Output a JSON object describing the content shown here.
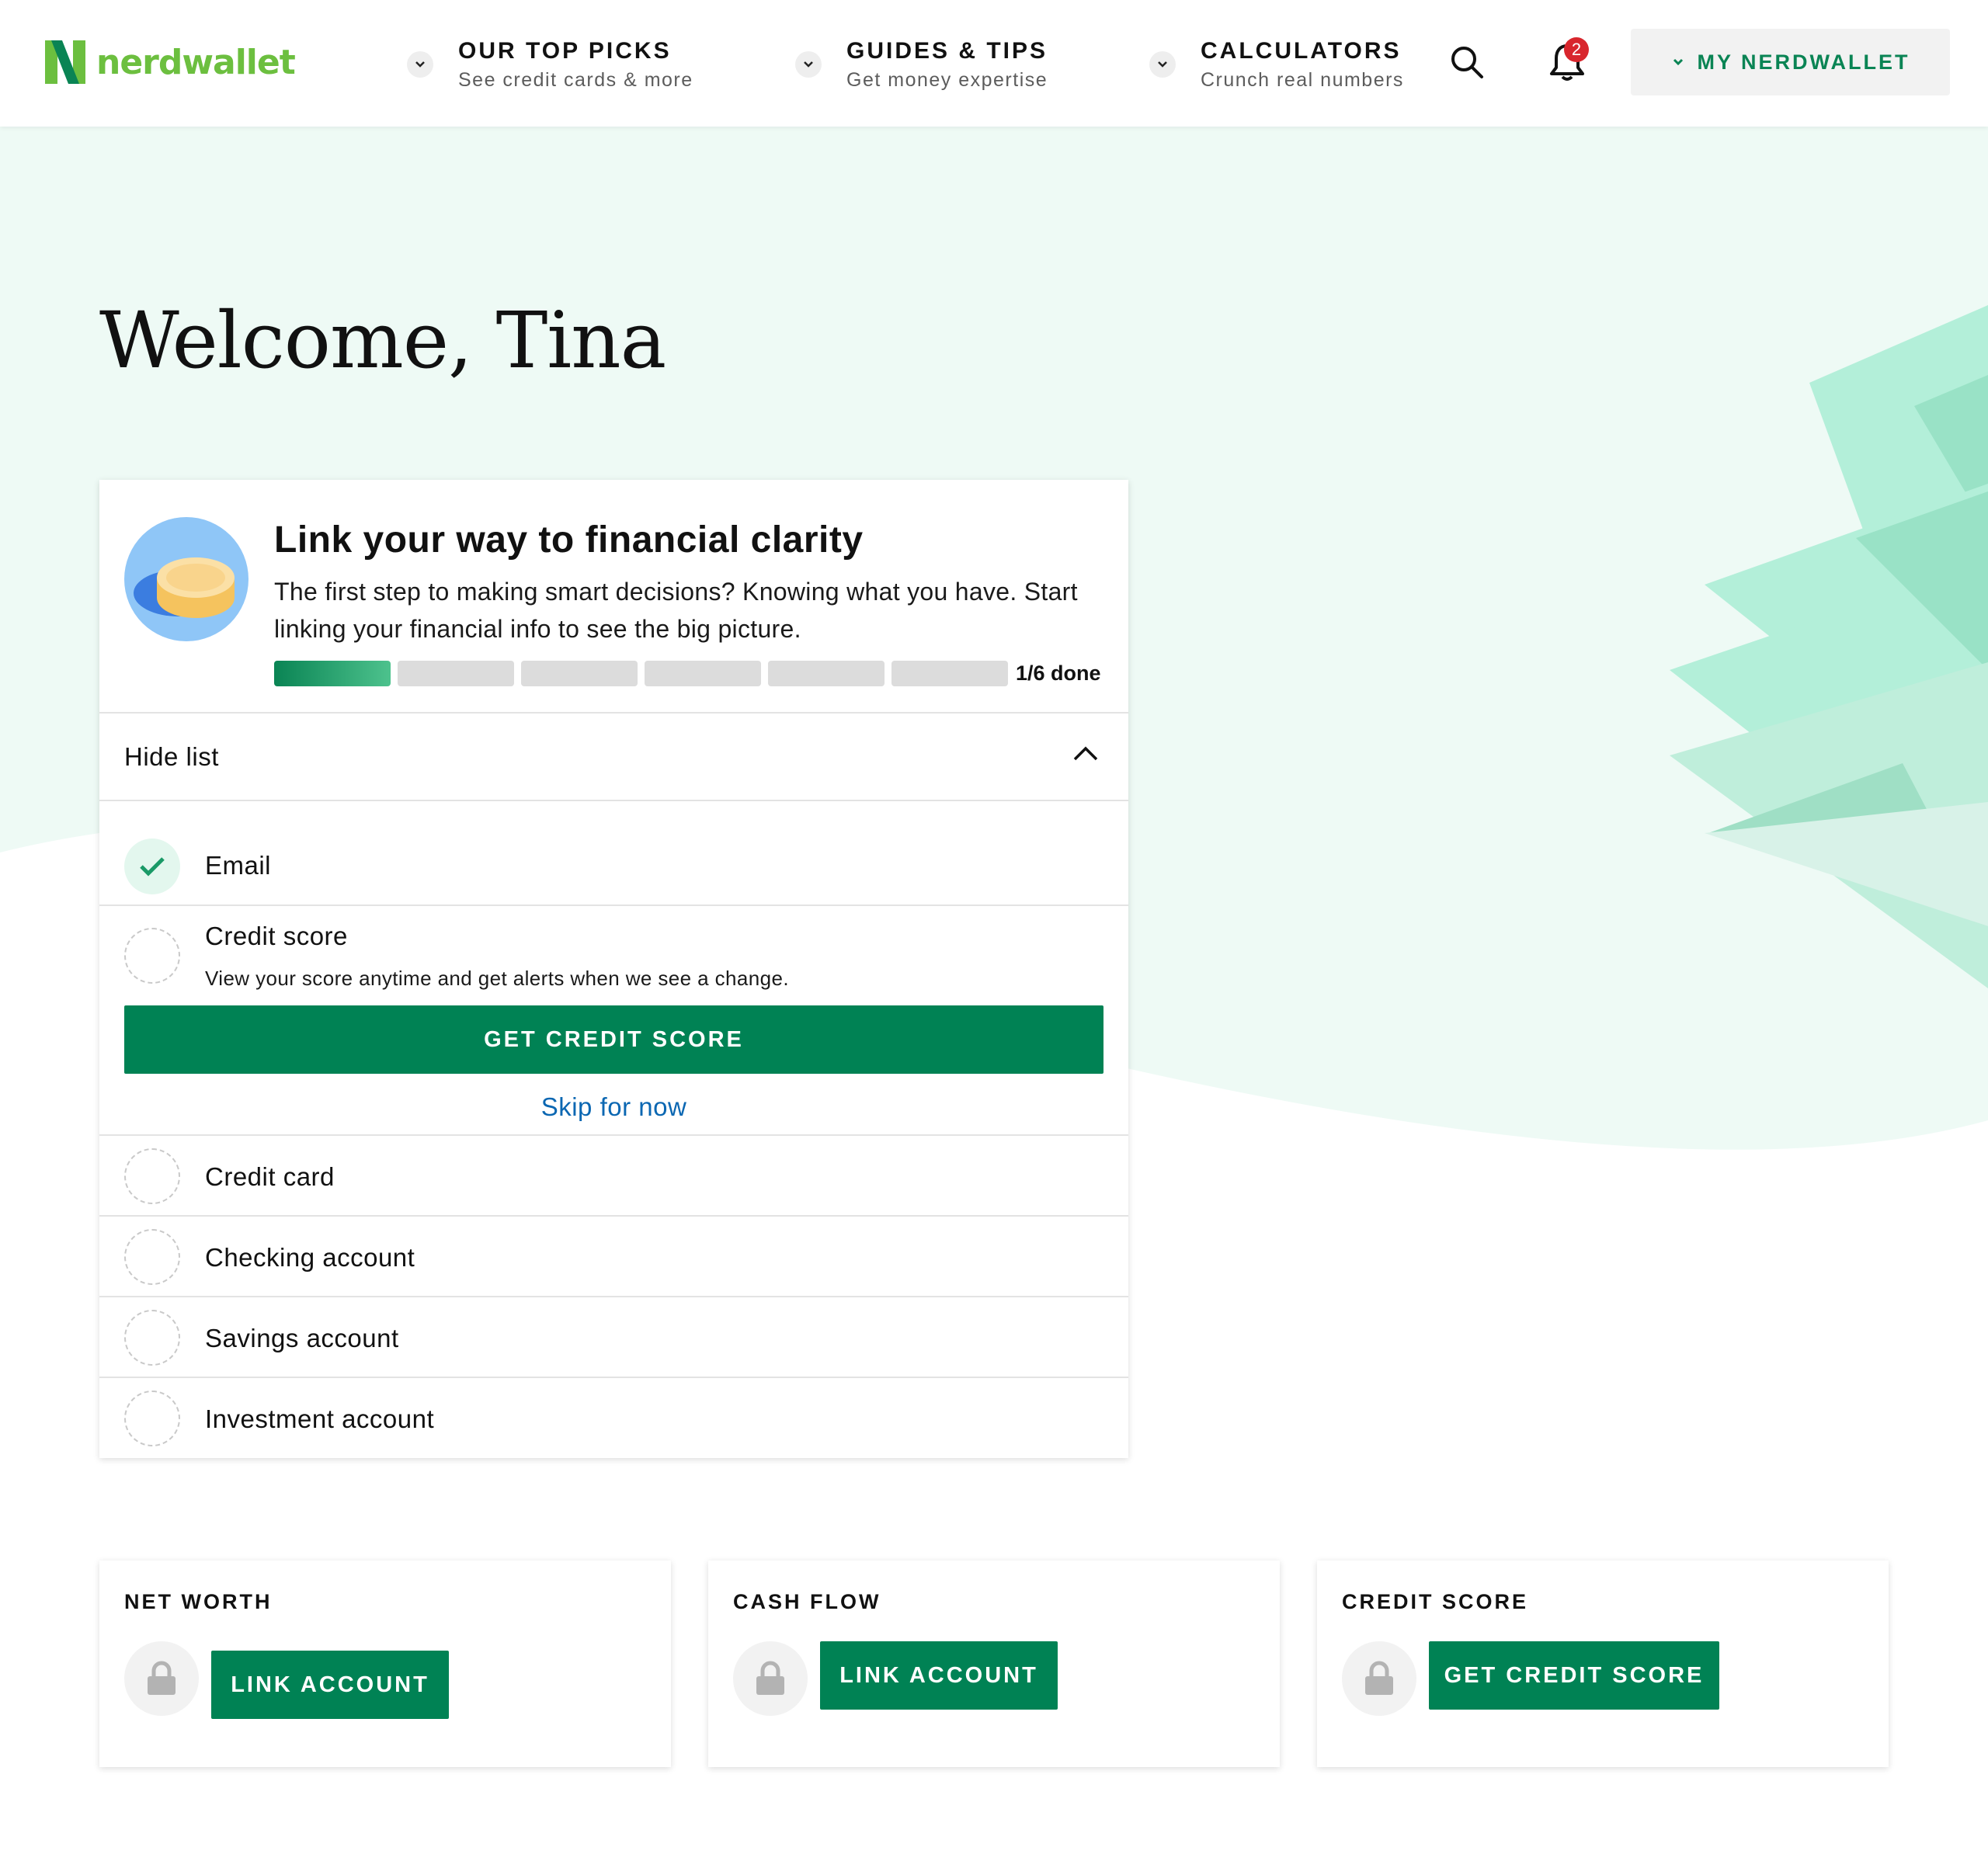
{
  "header": {
    "logo_text": "nerdwallet",
    "nav": [
      {
        "title": "OUR TOP PICKS",
        "subtitle": "See credit cards & more"
      },
      {
        "title": "GUIDES & TIPS",
        "subtitle": "Get money expertise"
      },
      {
        "title": "CALCULATORS",
        "subtitle": "Crunch real numbers"
      }
    ],
    "notifications_count": "2",
    "account_menu_label": "MY NERDWALLET"
  },
  "hero": {
    "welcome": "Welcome, Tina"
  },
  "onboarding": {
    "title": "Link your way to financial clarity",
    "description": "The first step to making smart decisions? Knowing what you have. Start linking your financial info to see the big picture.",
    "progress": {
      "completed": 1,
      "total": 6,
      "label": "1/6 done"
    },
    "toggle_label": "Hide list",
    "steps": [
      {
        "label": "Email",
        "done": true
      },
      {
        "label": "Credit score",
        "done": false,
        "description": "View your score anytime and get alerts when we see a change.",
        "button": "GET CREDIT SCORE",
        "skip": "Skip for now"
      },
      {
        "label": "Credit card",
        "done": false
      },
      {
        "label": "Checking account",
        "done": false
      },
      {
        "label": "Savings account",
        "done": false
      },
      {
        "label": "Investment account",
        "done": false
      }
    ]
  },
  "summary_cards": [
    {
      "title": "NET WORTH",
      "button": "LINK ACCOUNT"
    },
    {
      "title": "CASH FLOW",
      "button": "LINK ACCOUNT"
    },
    {
      "title": "CREDIT SCORE",
      "button": "GET CREDIT SCORE"
    }
  ],
  "colors": {
    "brand_green": "#008254",
    "logo_green": "#6cbf3f",
    "hero_mint": "#eefaf5",
    "link_blue": "#0b67b2",
    "badge_red": "#d8262d"
  }
}
